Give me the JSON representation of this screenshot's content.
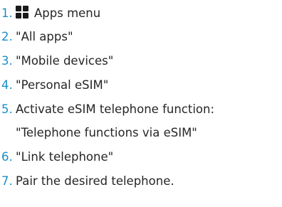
{
  "steps": [
    {
      "number": "1.",
      "icon": "apps-grid-icon",
      "text": "Apps menu"
    },
    {
      "number": "2.",
      "text": "\"All apps\""
    },
    {
      "number": "3.",
      "text": "\"Mobile devices\""
    },
    {
      "number": "4.",
      "text": "\"Personal eSIM\""
    },
    {
      "number": "5.",
      "text": "Activate eSIM telephone function:",
      "continuation": "\"Telephone functions via eSIM\""
    },
    {
      "number": "6.",
      "text": "\"Link telephone\""
    },
    {
      "number": "7.",
      "text": "Pair the desired telephone."
    }
  ]
}
